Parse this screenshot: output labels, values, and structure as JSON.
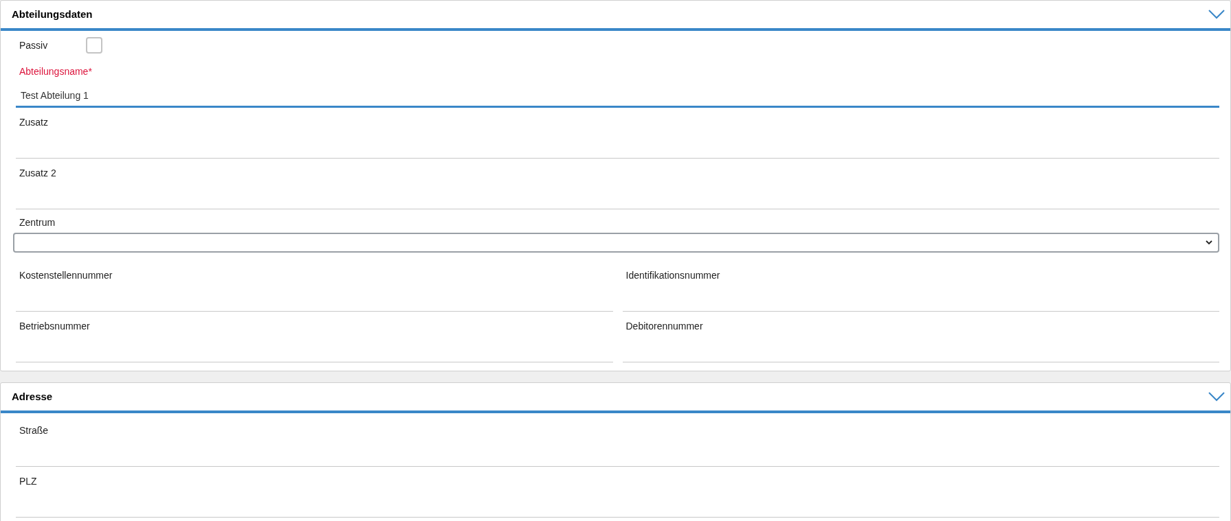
{
  "sections": [
    {
      "title": "Abteilungsdaten",
      "rows": [
        [
          {
            "kind": "checkbox",
            "label": "Passiv",
            "checked": false
          }
        ],
        [
          {
            "kind": "text",
            "label": "Abteilungsname*",
            "required": true,
            "value": "Test Abteilung 1",
            "focused": true
          }
        ],
        [
          {
            "kind": "text",
            "label": "Zusatz",
            "required": false,
            "focused": false
          }
        ],
        [
          {
            "kind": "text",
            "label": "Zusatz 2",
            "required": false,
            "focused": false
          }
        ],
        [
          {
            "kind": "select",
            "label": "Zentrum"
          }
        ],
        [
          {
            "kind": "text",
            "label": "Kostenstellennummer",
            "required": false,
            "focused": false
          },
          {
            "kind": "text",
            "label": "Identifikationsnummer",
            "required": false,
            "focused": false
          }
        ],
        [
          {
            "kind": "text",
            "label": "Betriebsnummer",
            "required": false,
            "focused": false
          },
          {
            "kind": "text",
            "label": "Debitorennummer",
            "required": false,
            "focused": false
          }
        ]
      ]
    },
    {
      "title": "Adresse",
      "rows": [
        [
          {
            "kind": "text",
            "label": "Straße",
            "required": false,
            "focused": false
          }
        ],
        [
          {
            "kind": "text",
            "label": "PLZ",
            "required": false,
            "focused": false
          }
        ]
      ]
    }
  ]
}
